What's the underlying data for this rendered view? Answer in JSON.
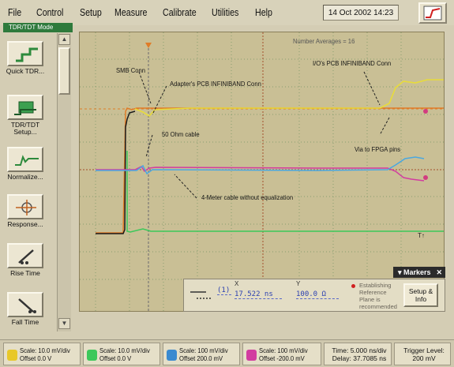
{
  "menu": [
    "File",
    "Control",
    "Setup",
    "Measure",
    "Calibrate",
    "Utilities",
    "Help"
  ],
  "datetime": "14 Oct 2002   14:23",
  "mode_label": "TDR/TDT Mode",
  "sidebar": [
    {
      "label": "Quick TDR...",
      "icon": "quick-tdr-icon"
    },
    {
      "label": "TDR/TDT Setup...",
      "icon": "tdr-setup-icon"
    },
    {
      "label": "Normalize...",
      "icon": "normalize-icon"
    },
    {
      "label": "Response...",
      "icon": "response-icon"
    },
    {
      "label": "Rise Time",
      "icon": "rise-time-icon"
    },
    {
      "label": "Fall Time",
      "icon": "fall-time-icon"
    }
  ],
  "graph": {
    "number_averages": "Number Averages = 16",
    "annotations": {
      "smb_conn": "SMB Conn",
      "adapter_pcb": "Adapter's PCB INFINIBAND Conn",
      "io_pcb": "I/O's PCB INFINIBAND Conn",
      "cable_50": "50 Ohm cable",
      "via_fpga": "Via to FPGA pins",
      "cable_4m": "4-Meter cable without equalization"
    },
    "trace_colors": {
      "yellow": "#e8dc3a",
      "blue": "#4aa8e0",
      "magenta": "#d23ca0",
      "green": "#3cc85a",
      "orange": "#e07c28",
      "black": "#1a1a1a"
    }
  },
  "markers": {
    "tab_label": "Markers",
    "channel_label": "(1)",
    "x_head": "X",
    "y_head": "Y",
    "x_value": "17.522 ns",
    "y_value": "100.0 Ω",
    "establishing_text": "Establishing Reference Plane is recommended",
    "setup_label": "Setup & Info"
  },
  "bottom": {
    "channels": [
      {
        "scale": "Scale: 10.0 mV/div",
        "offset": "Offset 0.0 V",
        "color": "#e8c828"
      },
      {
        "scale": "Scale: 10.0 mV/div",
        "offset": "Offset 0.0 V",
        "color": "#3cc85a"
      },
      {
        "scale": "Scale: 100 mV/div",
        "offset": "Offset 200.0 mV",
        "color": "#3a8ad0"
      },
      {
        "scale": "Scale: 100 mV/div",
        "offset": "Offset -200.0 mV",
        "color": "#d23ca0"
      }
    ],
    "time": "Time: 5.000 ns/div",
    "delay": "Delay: 37.7085 ns",
    "trigger_label": "Trigger Level:",
    "trigger_value": "200 mV"
  }
}
